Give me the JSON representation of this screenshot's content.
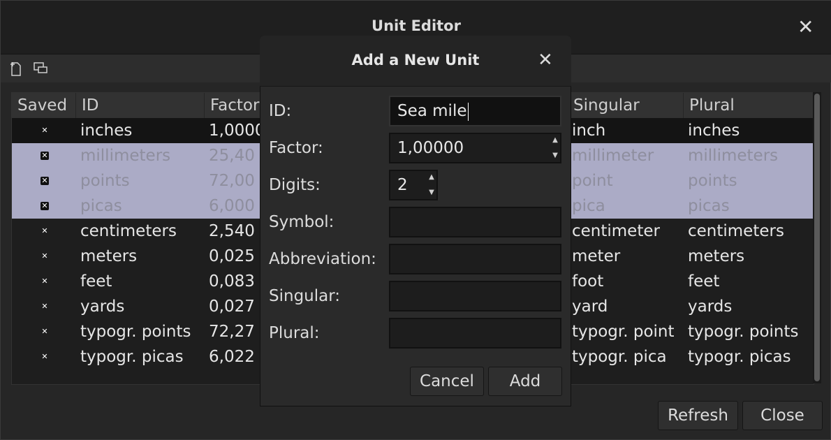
{
  "window": {
    "title": "Unit Editor"
  },
  "table": {
    "headers": {
      "saved": "Saved",
      "id": "ID",
      "factor": "Factor",
      "singular": "Singular",
      "plural": "Plural"
    },
    "rows": [
      {
        "id": "inches",
        "factor": "1,0000",
        "singular": "inch",
        "plural": "inches"
      },
      {
        "id": "millimeters",
        "factor": "25,40",
        "singular": "millimeter",
        "plural": "millimeters"
      },
      {
        "id": "points",
        "factor": "72,00",
        "singular": "point",
        "plural": "points"
      },
      {
        "id": "picas",
        "factor": "6,000",
        "singular": "pica",
        "plural": "picas"
      },
      {
        "id": "centimeters",
        "factor": "2,540",
        "singular": "centimeter",
        "plural": "centimeters"
      },
      {
        "id": "meters",
        "factor": "0,025",
        "singular": "meter",
        "plural": "meters"
      },
      {
        "id": "feet",
        "factor": "0,083",
        "singular": "foot",
        "plural": "feet"
      },
      {
        "id": "yards",
        "factor": "0,027",
        "singular": "yard",
        "plural": "yards"
      },
      {
        "id": "typogr. points",
        "factor": "72,27",
        "singular": "typogr. point",
        "plural": "typogr. points"
      },
      {
        "id": "typogr. picas",
        "factor": "6,022",
        "singular": "typogr. pica",
        "plural": "typogr. picas"
      }
    ]
  },
  "buttons": {
    "refresh": "Refresh",
    "close": "Close"
  },
  "dialog": {
    "title": "Add a New Unit",
    "labels": {
      "id": "ID:",
      "factor": "Factor:",
      "digits": "Digits:",
      "symbol": "Symbol:",
      "abbreviation": "Abbreviation:",
      "singular": "Singular:",
      "plural": "Plural:"
    },
    "values": {
      "id": "Sea mile",
      "factor": "1,00000",
      "digits": "2",
      "symbol": "",
      "abbreviation": "",
      "singular": "",
      "plural": ""
    },
    "cancel": "Cancel",
    "add": "Add"
  },
  "colors": {
    "selection": "#ababc6",
    "background": "#262626"
  }
}
